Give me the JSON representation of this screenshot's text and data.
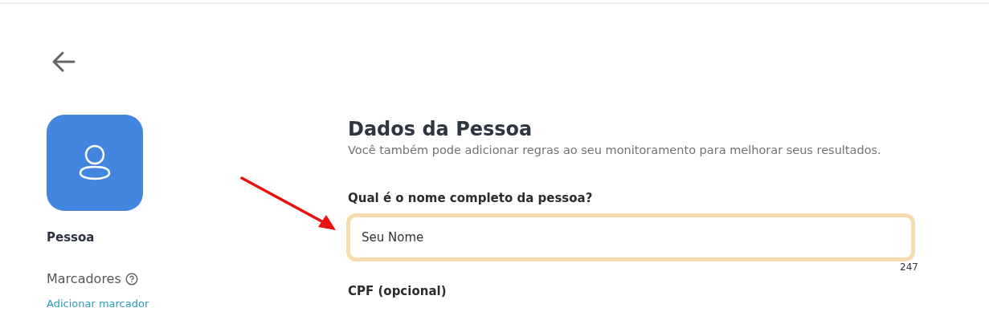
{
  "sidebar": {
    "title": "Pessoa",
    "tags_label": "Marcadores",
    "add_tag_link": "Adicionar marcador"
  },
  "form": {
    "title": "Dados da Pessoa",
    "subtitle": "Você também pode adicionar regras ao seu monitoramento para melhorar seus resultados.",
    "fields": [
      {
        "label": "Qual é o nome completo da pessoa?",
        "value": "Seu Nome",
        "focused": true,
        "counter": "247"
      },
      {
        "label": "CPF (opcional)"
      }
    ]
  }
}
